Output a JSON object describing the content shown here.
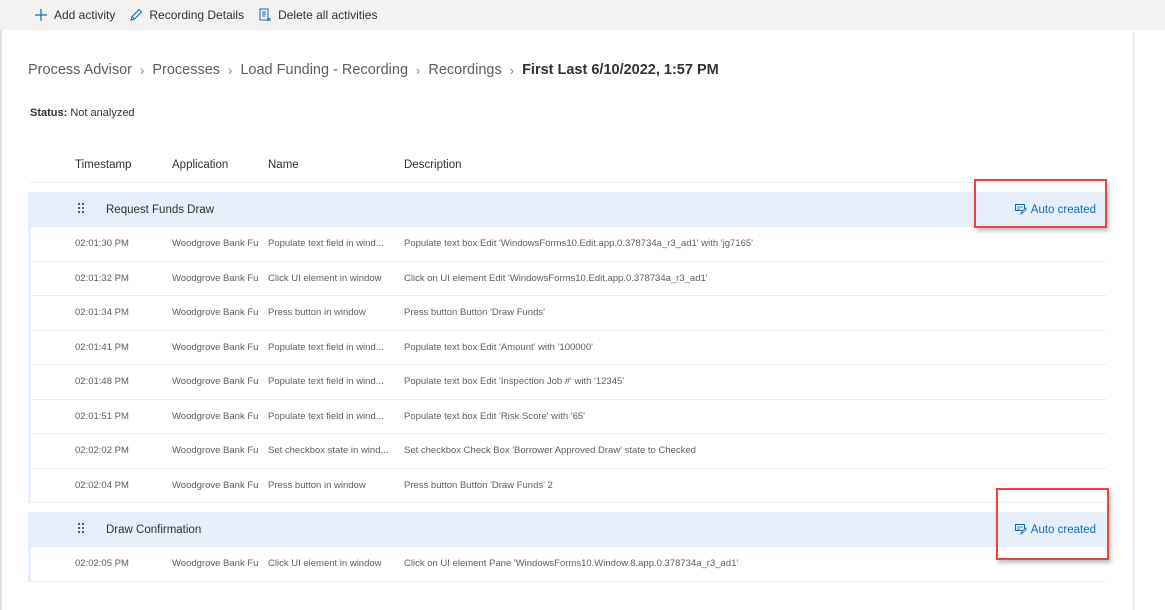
{
  "toolbar": {
    "add_activity": "Add activity",
    "recording_details": "Recording Details",
    "delete_all": "Delete all activities"
  },
  "breadcrumb": {
    "items": [
      "Process Advisor",
      "Processes",
      "Load Funding - Recording",
      "Recordings"
    ],
    "current": "First Last 6/10/2022, 1:57 PM",
    "separator": "›"
  },
  "status": {
    "label": "Status:",
    "value": "Not analyzed"
  },
  "table": {
    "columns": [
      "Timestamp",
      "Application",
      "Name",
      "Description"
    ],
    "groups": [
      {
        "title": "Request Funds Draw",
        "badge": "Auto created",
        "rows": [
          {
            "timestamp": "02:01:30 PM",
            "application": "Woodgrove Bank Fu",
            "name": "Populate text field in wind...",
            "description": "Populate text box Edit 'WindowsForms10.Edit.app.0.378734a_r3_ad1' with 'jg7165'"
          },
          {
            "timestamp": "02:01:32 PM",
            "application": "Woodgrove Bank Fu",
            "name": "Click UI element in window",
            "description": "Click on UI element Edit 'WindowsForms10.Edit.app.0.378734a_r3_ad1'"
          },
          {
            "timestamp": "02:01:34 PM",
            "application": "Woodgrove Bank Fu",
            "name": "Press button in window",
            "description": "Press button Button 'Draw Funds'"
          },
          {
            "timestamp": "02:01:41 PM",
            "application": "Woodgrove Bank Fu",
            "name": "Populate text field in wind...",
            "description": "Populate text box Edit 'Amount' with '100000'"
          },
          {
            "timestamp": "02:01:48 PM",
            "application": "Woodgrove Bank Fu",
            "name": "Populate text field in wind...",
            "description": "Populate text box Edit 'Inspection Job #' with '12345'"
          },
          {
            "timestamp": "02:01:51 PM",
            "application": "Woodgrove Bank Fu",
            "name": "Populate text field in wind...",
            "description": "Populate text box Edit 'Risk Score' with '65'"
          },
          {
            "timestamp": "02:02:02 PM",
            "application": "Woodgrove Bank Fu",
            "name": "Set checkbox state in wind...",
            "description": "Set checkbox Check Box 'Borrower Approved Draw' state to Checked"
          },
          {
            "timestamp": "02:02:04 PM",
            "application": "Woodgrove Bank Fu",
            "name": "Press button in window",
            "description": "Press button Button 'Draw Funds' 2"
          }
        ]
      },
      {
        "title": "Draw Confirmation",
        "badge": "Auto created",
        "rows": [
          {
            "timestamp": "02:02:05 PM",
            "application": "Woodgrove Bank Fu",
            "name": "Click UI element in window",
            "description": "Click on UI element Pane 'WindowsForms10.Window.8.app.0.378734a_r3_ad1'"
          }
        ]
      }
    ]
  },
  "colors": {
    "accent": "#0f6cbd",
    "group_header_bg": "#e6eefa",
    "highlight_border": "#ea4343",
    "toolbar_bg": "#f3f2f1"
  }
}
